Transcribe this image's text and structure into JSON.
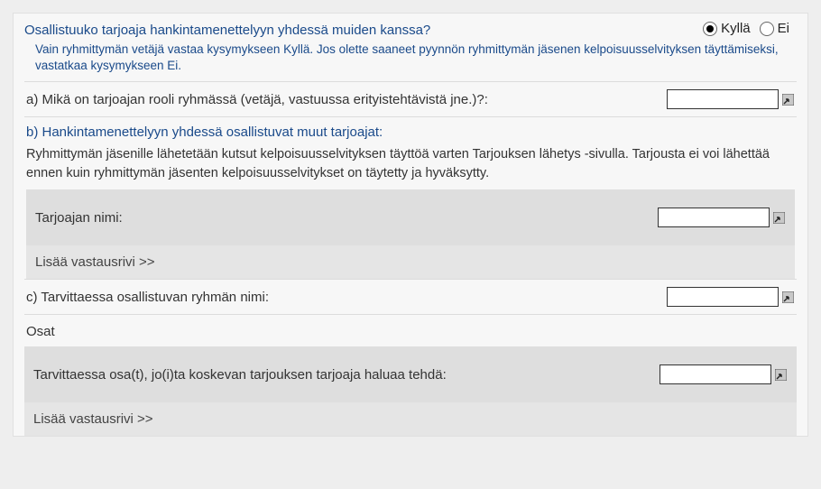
{
  "question": {
    "title": "Osallistuuko tarjoaja hankintamenettelyyn yhdessä muiden kanssa?",
    "yes": "Kyllä",
    "no": "Ei",
    "helper": "Vain ryhmittymän vetäjä vastaa kysymykseen Kyllä. Jos olette saaneet pyynnön ryhmittymän jäsenen kelpoisuusselvityksen täyttämiseksi, vastatkaa kysymykseen Ei."
  },
  "a": {
    "label": "a) Mikä on tarjoajan rooli ryhmässä (vetäjä, vastuussa erityistehtävistä jne.)?:",
    "value": ""
  },
  "b": {
    "title": "b) Hankintamenettelyyn yhdessä osallistuvat muut tarjoajat:",
    "text": "Ryhmittymän jäsenille lähetetään kutsut kelpoisuusselvityksen täyttöä varten Tarjouksen lähetys -sivulla. Tarjousta ei voi lähettää ennen kuin ryhmittymän jäsenten kelpoisuusselvitykset on täytetty ja hyväksytty.",
    "bidder_label": "Tarjoajan nimi:",
    "bidder_value": "",
    "add": "Lisää vastausrivi >>"
  },
  "c": {
    "label": "c) Tarvittaessa osallistuvan ryhmän nimi:",
    "value": ""
  },
  "parts": {
    "heading": "Osat",
    "label": "Tarvittaessa osa(t), jo(i)ta koskevan tarjouksen tarjoaja haluaa tehdä:",
    "value": "",
    "add": "Lisää vastausrivi >>"
  }
}
